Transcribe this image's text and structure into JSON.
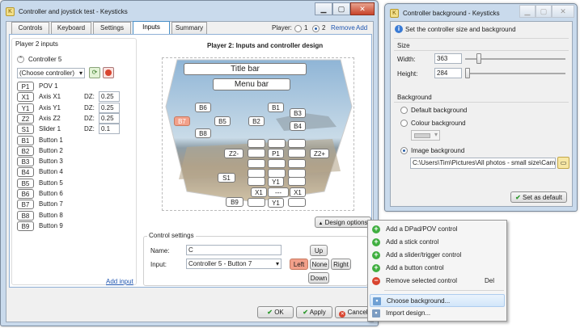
{
  "main_window": {
    "title": "Controller and joystick test - Keysticks",
    "tabs": [
      {
        "label": "Controls"
      },
      {
        "label": "Keyboard"
      },
      {
        "label": "Settings"
      },
      {
        "label": "Inputs"
      },
      {
        "label": "Summary"
      }
    ],
    "player_label": "Player:",
    "player_options": [
      "1",
      "2"
    ],
    "selected_player": "2",
    "remove_link": "Remove",
    "add_link": "Add",
    "inputs_group_title": "Player 2 inputs",
    "controller_node": "Controller 5",
    "controller_select": "(Choose controller)",
    "inputs": [
      {
        "key": "P1",
        "name": "POV 1"
      },
      {
        "key": "X1",
        "name": "Axis X1",
        "dz_label": "DZ:",
        "dz": "0.25"
      },
      {
        "key": "Y1",
        "name": "Axis Y1",
        "dz_label": "DZ:",
        "dz": "0.25"
      },
      {
        "key": "Z2",
        "name": "Axis Z2",
        "dz_label": "DZ:",
        "dz": "0.25"
      },
      {
        "key": "S1",
        "name": "Slider 1",
        "dz_label": "DZ:",
        "dz": "0.1"
      },
      {
        "key": "B1",
        "name": "Button 1"
      },
      {
        "key": "B2",
        "name": "Button 2"
      },
      {
        "key": "B3",
        "name": "Button 3"
      },
      {
        "key": "B4",
        "name": "Button 4"
      },
      {
        "key": "B5",
        "name": "Button 5"
      },
      {
        "key": "B6",
        "name": "Button 6"
      },
      {
        "key": "B7",
        "name": "Button 7"
      },
      {
        "key": "B8",
        "name": "Button 8"
      },
      {
        "key": "B9",
        "name": "Button 9"
      }
    ],
    "add_input_link": "Add input",
    "design_title": "Player 2: Inputs and controller design",
    "design": {
      "title_bar_box": "Title bar",
      "menu_bar_box": "Menu bar",
      "buttons": [
        "B6",
        "B1",
        "B3",
        "B7",
        "B5",
        "B2",
        "B4",
        "B8",
        "Z2-",
        "P1",
        "Z2+",
        "S1",
        "Y1",
        "X1",
        "---",
        "X1",
        "B9",
        "Y1"
      ]
    },
    "design_options_button": "Design options",
    "control_settings": {
      "group_title": "Control settings",
      "name_label": "Name:",
      "name_value": "C",
      "input_label": "Input:",
      "input_value": "Controller 5 - Button 7",
      "up": "Up",
      "left": "Left",
      "none": "None",
      "right": "Right",
      "down": "Down"
    },
    "ok": "OK",
    "apply": "Apply",
    "cancel": "Cancel"
  },
  "context_menu": {
    "items": [
      {
        "label": "Add a DPad/POV control",
        "icon": "add-icon"
      },
      {
        "label": "Add a stick control",
        "icon": "add-icon"
      },
      {
        "label": "Add a slider/trigger control",
        "icon": "add-icon"
      },
      {
        "label": "Add a button control",
        "icon": "add-icon"
      },
      {
        "label": "Remove selected control",
        "shortcut": "Del",
        "icon": "remove-icon"
      },
      {
        "label": "Choose background...",
        "icon": "picture-icon"
      },
      {
        "label": "Import design...",
        "icon": "import-icon"
      }
    ]
  },
  "bg_window": {
    "title": "Controller background - Keysticks",
    "info": "Set the controller size and background",
    "size_group": "Size",
    "width_label": "Width:",
    "width_value": "363",
    "width_fraction": 0.12,
    "height_label": "Height:",
    "height_value": "284",
    "height_fraction": 0.0,
    "background_group": "Background",
    "options": [
      "Default background",
      "Colour background",
      "Image background"
    ],
    "selected_option": "Image background",
    "path": "C:\\Users\\Tim\\Pictures\\All photos - small size\\Cam",
    "set_default": "Set as default"
  },
  "colors": {
    "accent": "#3a7bd5",
    "selected_control": "#f2a08a",
    "add_green": "#3fae3f",
    "remove_red": "#d9442f",
    "link_blue": "#1f55b0"
  }
}
